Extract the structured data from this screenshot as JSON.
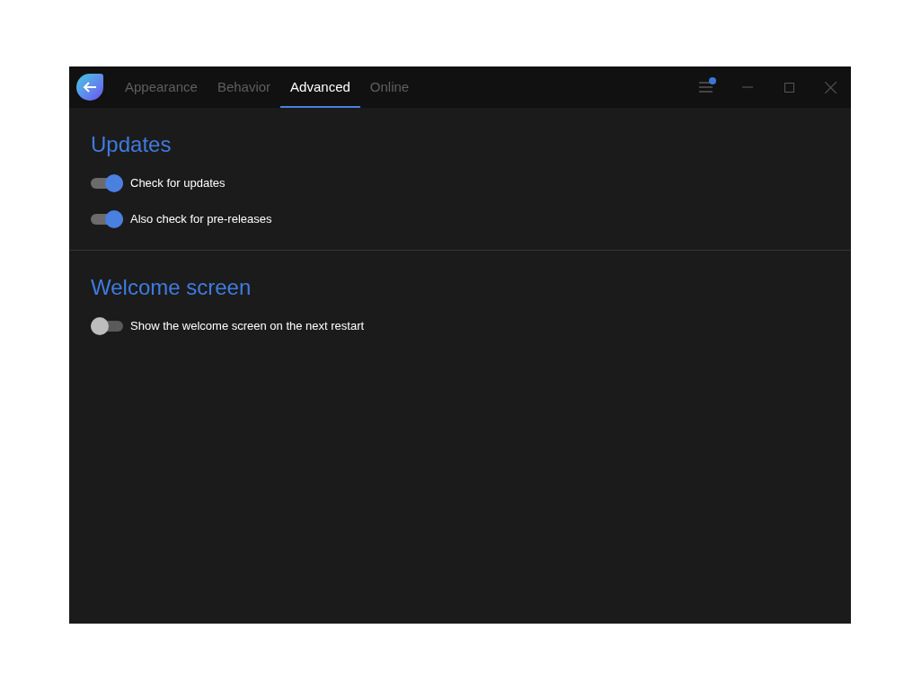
{
  "tabs": [
    {
      "label": "Appearance",
      "selected": false
    },
    {
      "label": "Behavior",
      "selected": false
    },
    {
      "label": "Advanced",
      "selected": true
    },
    {
      "label": "Online",
      "selected": false
    }
  ],
  "menu_badge": true,
  "sections": [
    {
      "title": "Updates",
      "settings": [
        {
          "label": "Check for updates",
          "on": true
        },
        {
          "label": "Also check for pre-releases",
          "on": true
        }
      ]
    },
    {
      "title": "Welcome screen",
      "settings": [
        {
          "label": "Show the welcome screen on the next restart",
          "on": false
        }
      ]
    }
  ]
}
